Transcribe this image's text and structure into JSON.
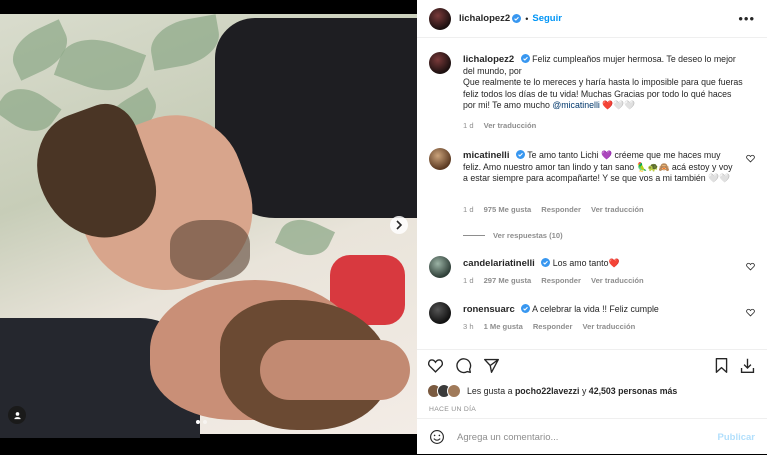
{
  "post": {
    "username": "lichalopez2",
    "follow_label": "Seguir",
    "more_label": "•••",
    "caption": {
      "username": "lichalopez2",
      "text": "Feliz cumpleaños mujer hermosa. Te deseo lo mejor del mundo, por",
      "text2": "Que realmente te lo mereces y haría hasta lo imposible para que fueras feliz todos los días de tu vida! Muchas Gracias por todo lo qué haces por mi! Te amo mucho",
      "mention": "@micatinelli",
      "emoji_tail": "❤️🤍🤍",
      "time": "1 d",
      "translate": "Ver traducción"
    }
  },
  "comments": [
    {
      "username": "micatinelli",
      "text": "Te amo tanto Lichi 💜 créeme que me haces muy feliz. Amo nuestro amor tan lindo y tan sano 🦜🐢🙈 acá estoy y voy a estar siempre para acompañarte! Y se que vos a mi también 🤍🤍",
      "time": "1 d",
      "likes": "975 Me gusta",
      "reply": "Responder",
      "translate": "Ver traducción"
    },
    {
      "username": "candelariatinelli",
      "text": "Los amo tanto❤️",
      "time": "1 d",
      "likes": "297 Me gusta",
      "reply": "Responder",
      "translate": "Ver traducción"
    },
    {
      "username": "ronensuarc",
      "text": "A celebrar la vida !! Feliz cumple",
      "time": "3 h",
      "likes": "1 Me gusta",
      "reply": "Responder",
      "translate": "Ver traducción"
    }
  ],
  "view_replies": "Ver respuestas (10)",
  "likes": {
    "prefix": "Les gusta a",
    "user": "pocho22lavezzi",
    "joiner": "y",
    "count": "42,503 personas más"
  },
  "time_ago": "HACE UN DÍA",
  "add_comment": {
    "placeholder": "Agrega un comentario...",
    "publish": "Publicar"
  },
  "icons": {
    "like": "heart-icon",
    "comment": "comment-icon",
    "share": "share-icon",
    "save": "bookmark-icon",
    "emoji": "emoji-icon",
    "next": "chevron-right-icon",
    "tag": "user-tag-icon"
  },
  "colors": {
    "accent": "#0095f6",
    "verified": "#3897f0",
    "publish_disabled": "#b2dffc",
    "meta": "#8e8e8e"
  }
}
